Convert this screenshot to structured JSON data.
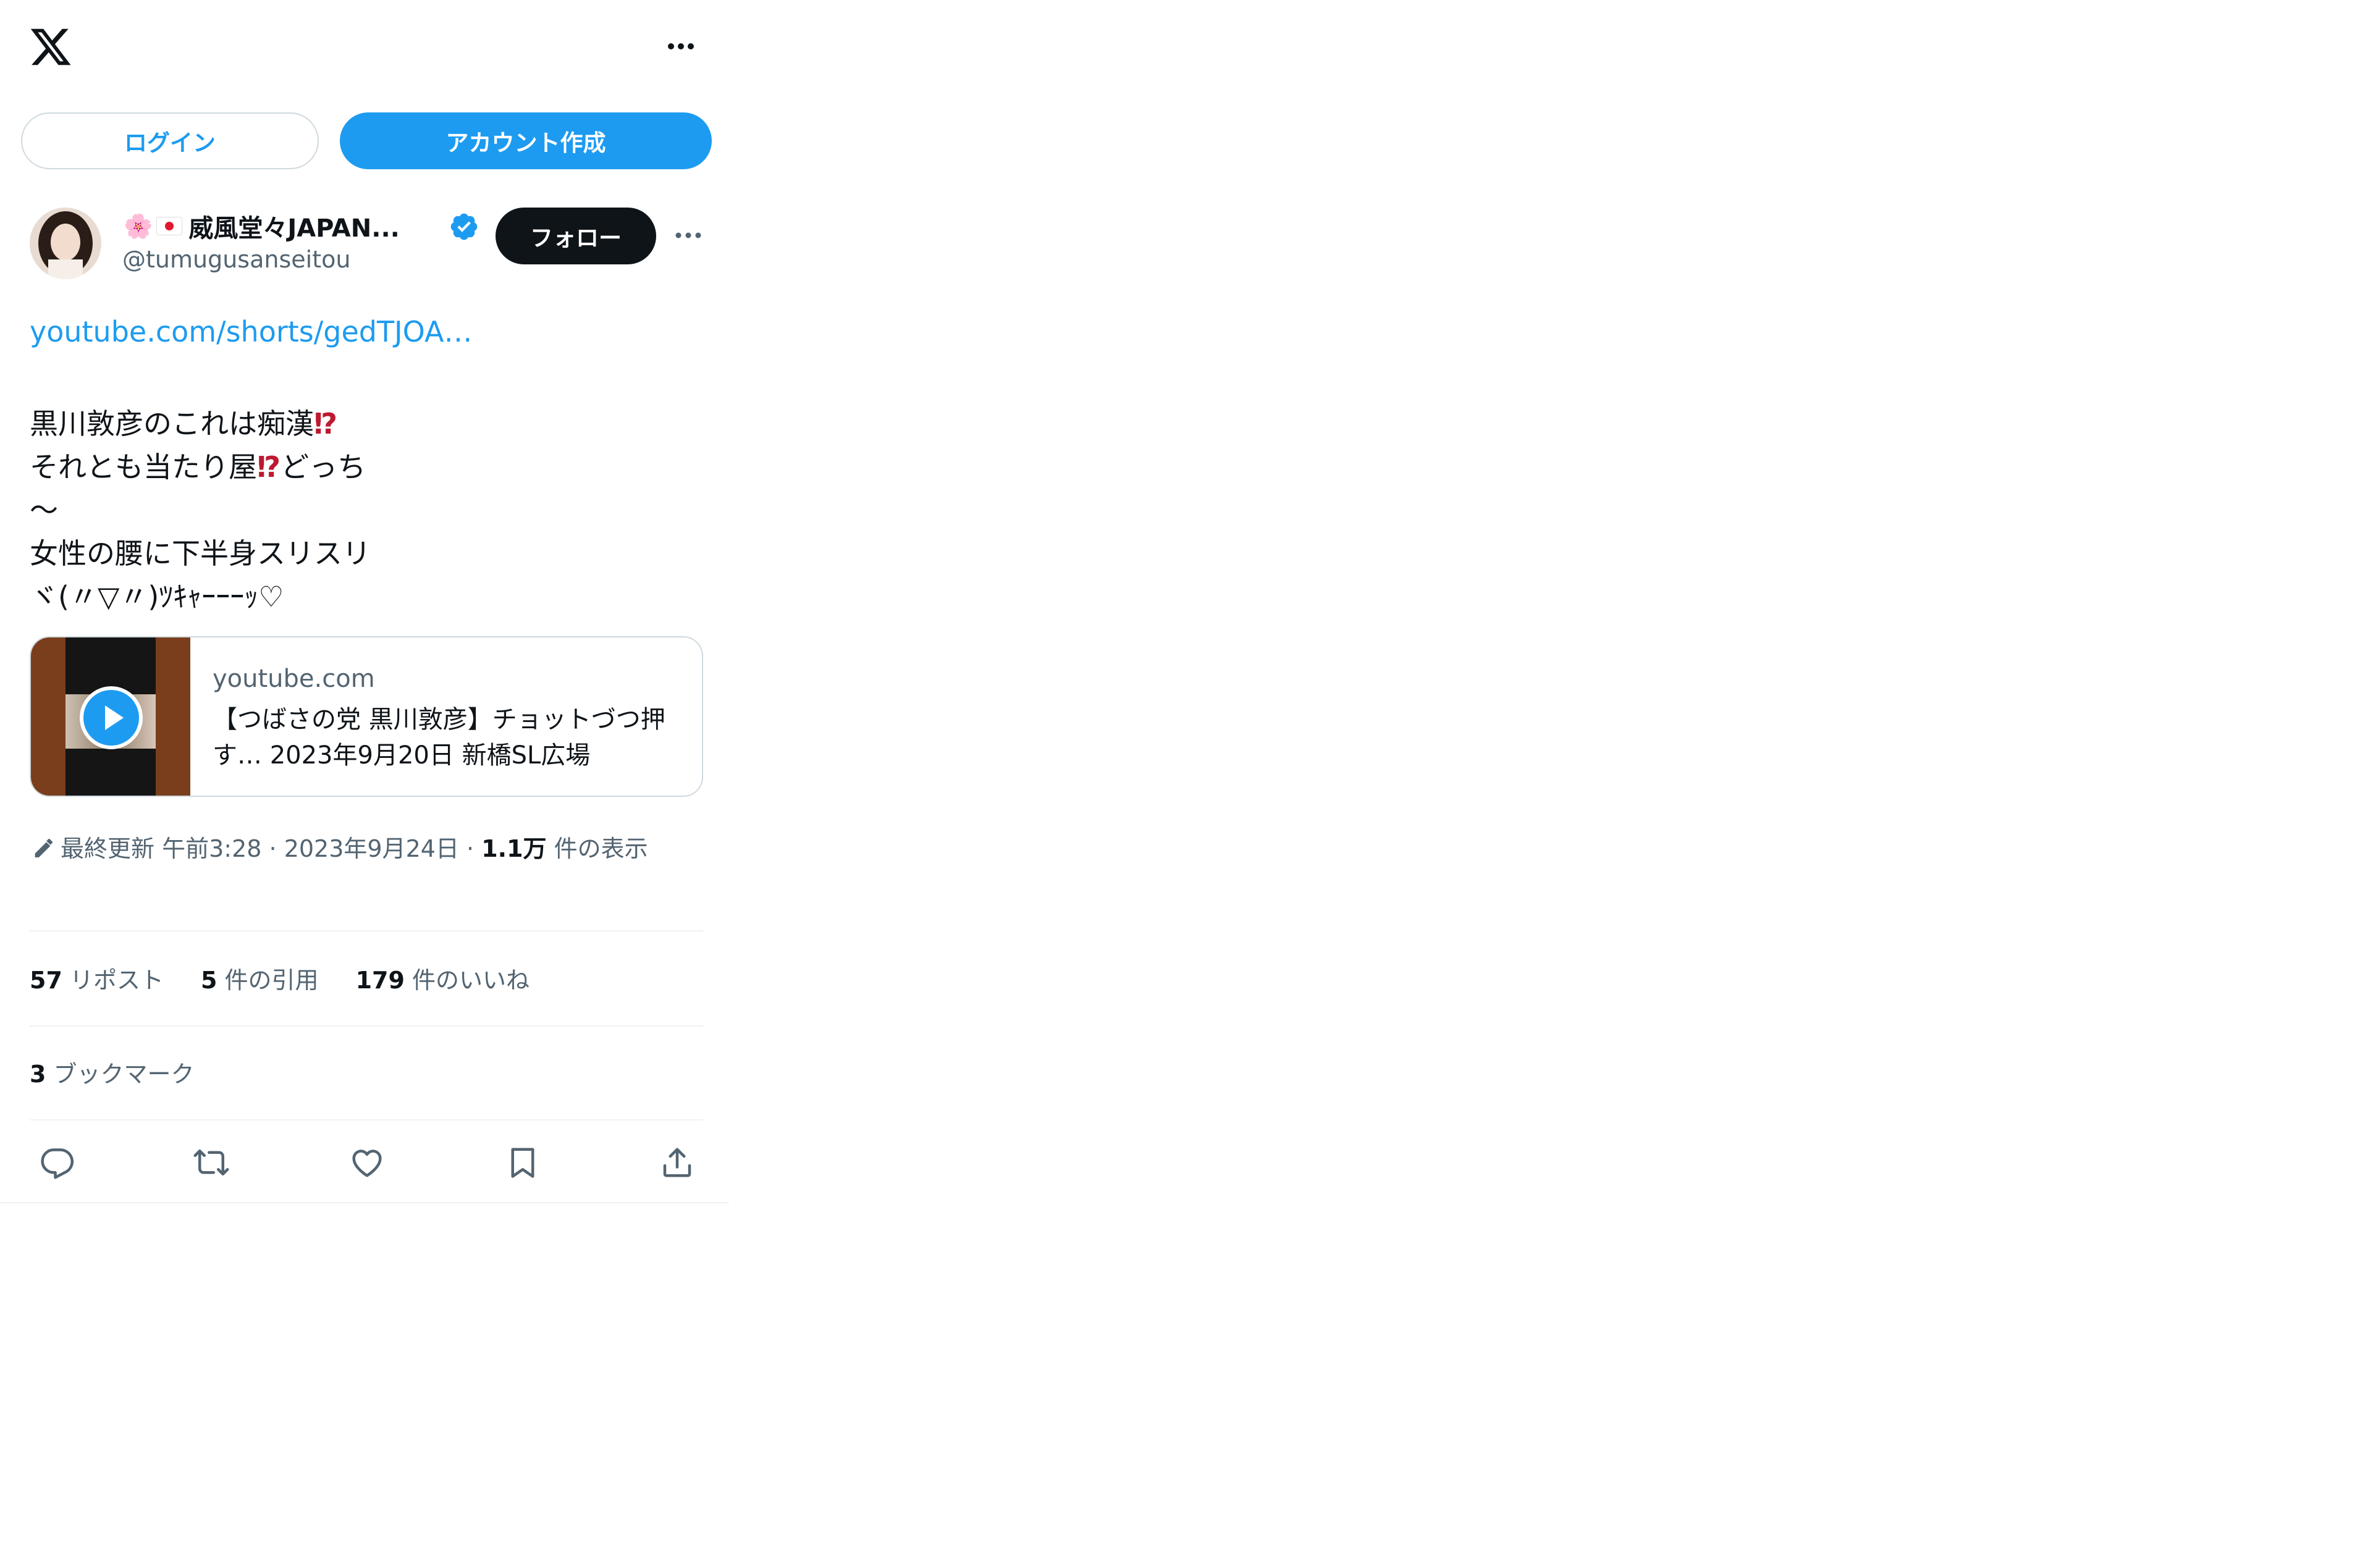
{
  "topbar": {
    "logo_icon": "x-logo-icon",
    "more_icon": "more-horizontal-icon"
  },
  "auth": {
    "login_label": "ログイン",
    "create_account_label": "アカウント作成"
  },
  "tweet": {
    "author": {
      "emoji": "🌸",
      "display_name": "威風堂々JAPAN...",
      "handle": "@tumugusanseitou",
      "verified": true
    },
    "follow_label": "フォロー",
    "link": "youtube.com/shorts/gedTJOA…",
    "lines": [
      {
        "text": "黒川敦彦のこれは痴漢",
        "emoji": "⁉"
      },
      {
        "text": "それとも当たり屋",
        "emoji": "⁉",
        "after": "どっち"
      },
      {
        "text": "～"
      },
      {
        "text": "女性の腰に下半身スリスリ"
      },
      {
        "text": "ヾ(〃▽〃)ﾂｷｬｰｰｰｯ♡"
      }
    ],
    "card": {
      "domain": "youtube.com",
      "title": "【つばさの党 黒川敦彦】チョットづつ押す… 2023年9月20日 新橋SL広場"
    },
    "meta": {
      "edited_label": "最終更新",
      "time": "午前3:28",
      "date": "2023年9月24日",
      "views": "1.1万",
      "views_label": "件の表示"
    },
    "stats": {
      "reposts": "57",
      "reposts_label": "リポスト",
      "quotes": "5",
      "quotes_label": "件の引用",
      "likes": "179",
      "likes_label": "件のいいね",
      "bookmarks": "3",
      "bookmarks_label": "ブックマーク"
    }
  },
  "colors": {
    "accent": "#1d9bf0",
    "text": "#0f1419",
    "secondary": "#536471",
    "border": "#cfd9de",
    "emoji_red": "#be1931"
  }
}
